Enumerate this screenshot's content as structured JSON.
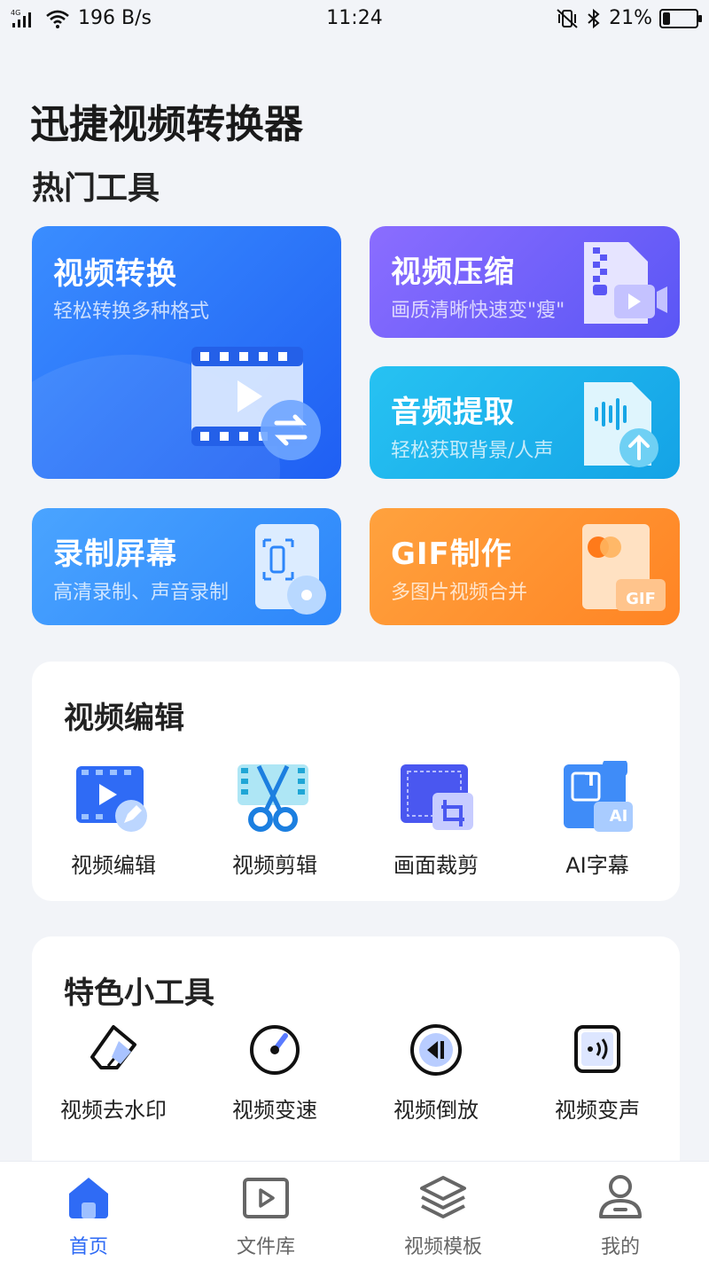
{
  "status_bar": {
    "network_type": "4G",
    "speed": "196 B/s",
    "time": "11:24",
    "battery": "21%",
    "battery_level": 0.21
  },
  "app_title": "迅捷视频转换器",
  "hot_section_title": "热门工具",
  "hot_tools": [
    {
      "title": "视频转换",
      "subtitle": "轻松转换多种格式"
    },
    {
      "title": "视频压缩",
      "subtitle": "画质清晰快速变\"瘦\""
    },
    {
      "title": "音频提取",
      "subtitle": "轻松获取背景/人声"
    },
    {
      "title": "录制屏幕",
      "subtitle": "高清录制、声音录制"
    },
    {
      "title": "GIF制作",
      "subtitle": "多图片视频合并",
      "badge": "GIF"
    }
  ],
  "edit_section": {
    "title": "视频编辑",
    "items": [
      {
        "label": "视频编辑",
        "icon": "video-edit-icon"
      },
      {
        "label": "视频剪辑",
        "icon": "scissors-icon"
      },
      {
        "label": "画面裁剪",
        "icon": "crop-icon"
      },
      {
        "label": "AI字幕",
        "icon": "ai-subtitle-icon",
        "badge_t": "T",
        "badge_ai": "AI"
      }
    ]
  },
  "tools_section": {
    "title": "特色小工具",
    "items": [
      {
        "label": "视频去水印",
        "icon": "eraser-icon"
      },
      {
        "label": "视频变速",
        "icon": "speedometer-icon"
      },
      {
        "label": "视频倒放",
        "icon": "rewind-icon"
      },
      {
        "label": "视频变声",
        "icon": "voice-change-icon"
      }
    ]
  },
  "bottom_nav": [
    {
      "label": "首页",
      "icon": "home-icon",
      "active": true
    },
    {
      "label": "文件库",
      "icon": "file-library-icon",
      "active": false
    },
    {
      "label": "视频模板",
      "icon": "layers-icon",
      "active": false
    },
    {
      "label": "我的",
      "icon": "user-icon",
      "active": false
    }
  ],
  "colors": {
    "accent": "#2f6bf5",
    "convert_card": "#2a72f8",
    "compress_card": "#6f60f8",
    "audio_card": "#1db3ec",
    "record_card": "#3a95fc",
    "gif_card": "#ff9431"
  }
}
